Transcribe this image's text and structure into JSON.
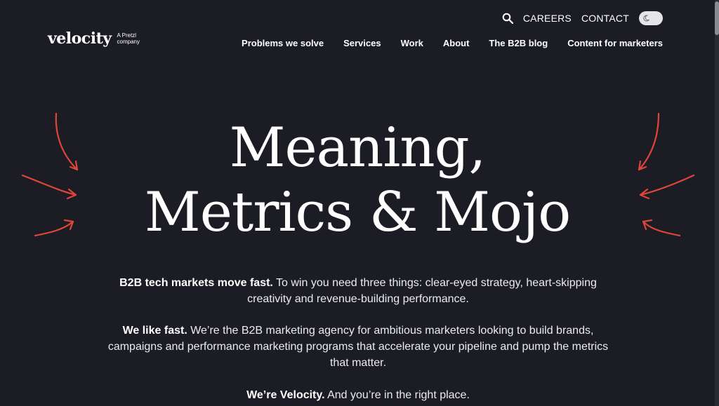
{
  "brand": {
    "name": "velocity",
    "tagline_line1": "A Pretzl",
    "tagline_line2": "company"
  },
  "utility_nav": {
    "search_icon": "search-icon",
    "careers": "CAREERS",
    "contact": "CONTACT",
    "theme_toggle_icon": "moon-icon"
  },
  "main_nav": {
    "items": [
      {
        "label": "Problems we solve"
      },
      {
        "label": "Services"
      },
      {
        "label": "Work"
      },
      {
        "label": "About"
      },
      {
        "label": "The B2B blog"
      },
      {
        "label": "Content for marketers"
      }
    ]
  },
  "hero": {
    "title_line1": "Meaning,",
    "title_line2": "Metrics & Mojo"
  },
  "intro": {
    "p1_bold": "B2B tech markets move fast.",
    "p1_text": " To win you need three things: clear-eyed strategy, heart-skipping creativity and revenue-building performance.",
    "p2_bold": "We like fast.",
    "p2_text": " We’re the B2B marketing agency for ambitious marketers looking to build brands, campaigns and performance marketing programs that accelerate your pipeline and pump the metrics that matter.",
    "p3_bold": "We’re Velocity.",
    "p3_text": " And you’re in the right place."
  },
  "colors": {
    "background": "#1b1c24",
    "accent_arrow": "#e0453a",
    "text": "#ffffff"
  }
}
